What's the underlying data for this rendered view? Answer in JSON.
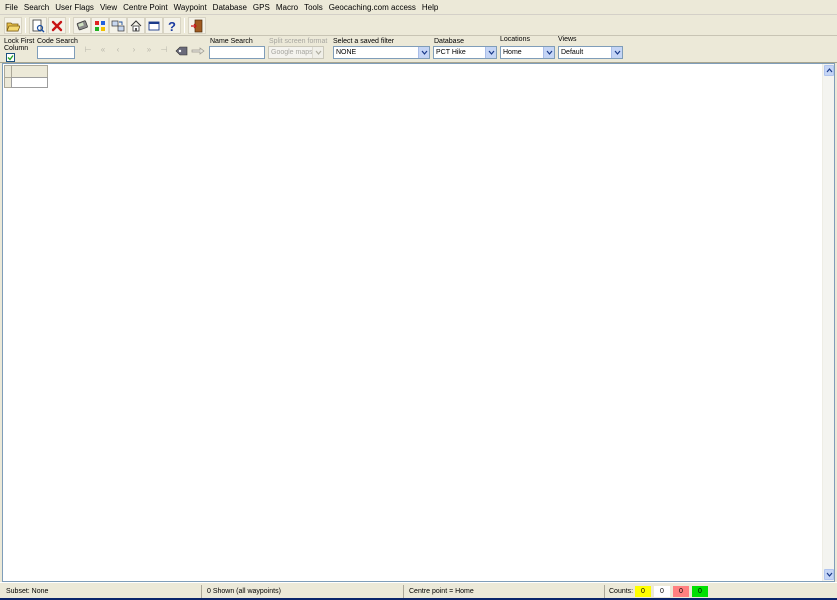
{
  "menu": [
    "File",
    "Search",
    "User Flags",
    "View",
    "Centre Point",
    "Waypoint",
    "Database",
    "GPS",
    "Macro",
    "Tools",
    "Geocaching.com access",
    "Help"
  ],
  "toolbar": {
    "icons": [
      "open-folder-icon",
      "print-preview-icon",
      "delete-icon",
      "gps-receiver-icon",
      "color-grid-icon",
      "sync-icon",
      "home-icon",
      "window-icon",
      "help-icon",
      "exit-icon"
    ]
  },
  "filters": {
    "lock_first_column_label_1": "Lock First",
    "lock_first_column_label_2": "Column",
    "lock_first_column_checked": true,
    "code_search_label": "Code Search",
    "code_search_value": "",
    "name_search_label": "Name Search",
    "name_search_value": "",
    "split_screen_label": "Split screen format",
    "split_screen_value": "Google maps",
    "saved_filter_label": "Select a saved filter",
    "saved_filter_value": "NONE",
    "database_label": "Database",
    "database_value": "PCT Hike",
    "locations_label": "Locations",
    "locations_value": "Home",
    "views_label": "Views",
    "views_value": "Default"
  },
  "status": {
    "subset": "Subset: None",
    "shown": "0 Shown (all waypoints)",
    "centre": "Centre point = Home",
    "counts_label": "Counts:",
    "counts": [
      {
        "value": "0",
        "color": "#ffff00"
      },
      {
        "value": "0",
        "color": "#ffffff"
      },
      {
        "value": "0",
        "color": "#ff8080"
      },
      {
        "value": "0",
        "color": "#00e000"
      }
    ]
  }
}
